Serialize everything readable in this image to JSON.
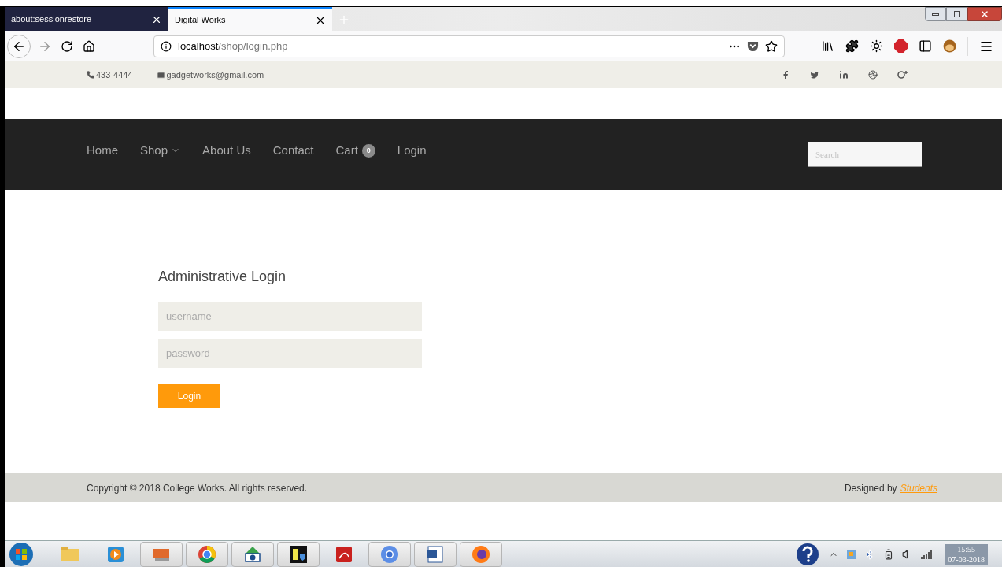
{
  "browser": {
    "tabs": [
      {
        "title": "about:sessionrestore",
        "selected": false
      },
      {
        "title": "Digital Works",
        "selected": true
      }
    ],
    "url": {
      "host": "localhost",
      "path": "/shop/login.php"
    }
  },
  "topbar": {
    "phone": "433-4444",
    "email": "gadgetworks@gmail.com"
  },
  "nav": {
    "items": [
      {
        "label": "Home",
        "dropdown": false
      },
      {
        "label": "Shop",
        "dropdown": true
      },
      {
        "label": "About Us",
        "dropdown": false
      },
      {
        "label": "Contact",
        "dropdown": false
      },
      {
        "label": "Cart",
        "dropdown": false,
        "badge": "0"
      },
      {
        "label": "Login",
        "dropdown": false
      }
    ],
    "search": {
      "placeholder": "Search"
    }
  },
  "login": {
    "title": "Administrative Login",
    "username": {
      "placeholder": "username"
    },
    "password": {
      "placeholder": "password"
    },
    "button": "Login"
  },
  "footer": {
    "copyright": "Copyright © 2018 College Works. All rights reserved.",
    "credit": "Designed by",
    "credit_link": "Students"
  },
  "taskbar": {
    "time": "15:55",
    "date": "07-03-2018"
  }
}
